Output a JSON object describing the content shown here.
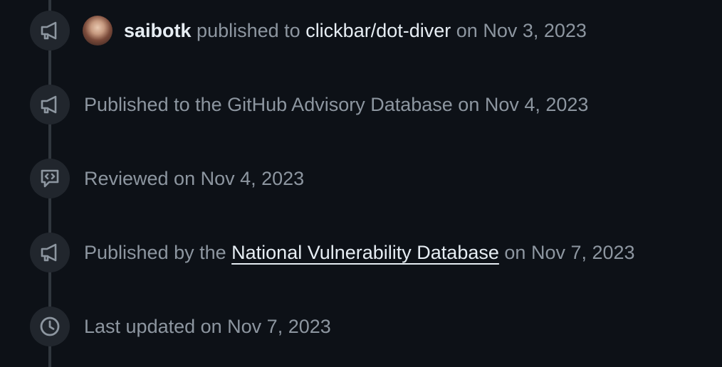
{
  "timeline": {
    "items": [
      {
        "icon": "megaphone-icon",
        "author": "saibotk",
        "verb": "published to",
        "repo": "clickbar/dot-diver",
        "date": "on Nov 3, 2023"
      },
      {
        "icon": "megaphone-icon",
        "text": "Published to the GitHub Advisory Database on Nov 4, 2023"
      },
      {
        "icon": "code-review-icon",
        "text": "Reviewed on Nov 4, 2023"
      },
      {
        "icon": "megaphone-icon",
        "prefix": "Published by the",
        "link": "National Vulnerability Database",
        "suffix": "on Nov 7, 2023"
      },
      {
        "icon": "clock-icon",
        "text": "Last updated on Nov 7, 2023"
      }
    ]
  },
  "colors": {
    "background": "#0d1117",
    "muted_text": "#8d96a0",
    "strong_text": "#e6edf3",
    "badge_bg": "#21262d",
    "timeline_line": "#30363d"
  }
}
